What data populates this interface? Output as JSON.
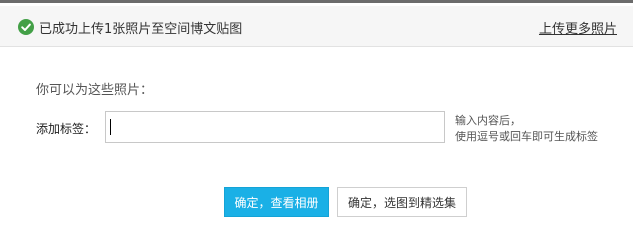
{
  "header": {
    "status_icon": "check-circle-icon",
    "status_color": "#43a047",
    "title": "已成功上传1张照片至空间博文贴图",
    "upload_more_label": "上传更多照片"
  },
  "main": {
    "prompt": "你可以为这些照片：",
    "tag_label": "添加标签：",
    "tag_input": {
      "value": "",
      "placeholder": ""
    },
    "hint_line1": "输入内容后，",
    "hint_line2": "使用逗号或回车即可生成标签"
  },
  "actions": {
    "primary_label": "确定，查看相册",
    "primary_color": "#1ab0e6",
    "secondary_label": "确定，选图到精选集"
  }
}
